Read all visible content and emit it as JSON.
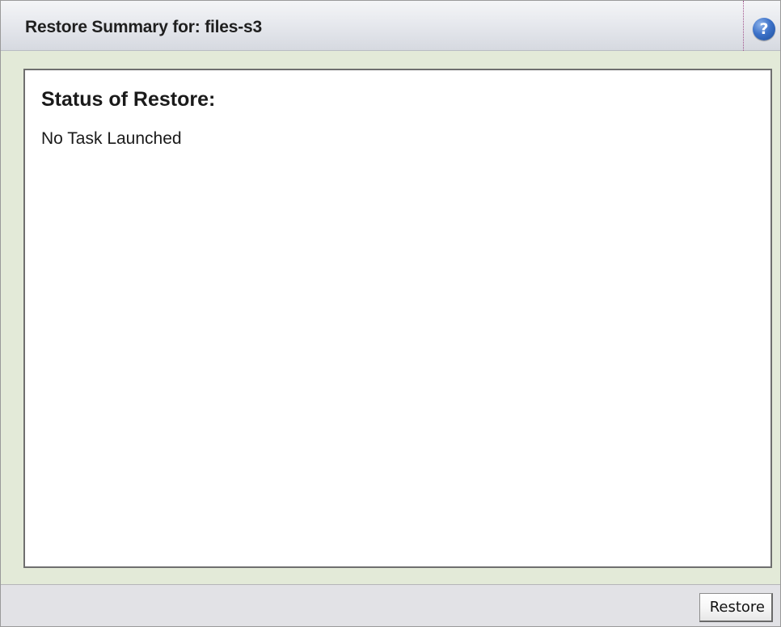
{
  "header": {
    "title": "Restore Summary for: files-s3",
    "help_icon": "question-mark-icon",
    "help_glyph": "?"
  },
  "content": {
    "status_heading": "Status of Restore:",
    "status_value": "No Task Launched"
  },
  "footer": {
    "restore_button_label": "Restore"
  },
  "colors": {
    "panel_background": "#e3ead8",
    "help_icon_blue": "#3d72c9"
  }
}
